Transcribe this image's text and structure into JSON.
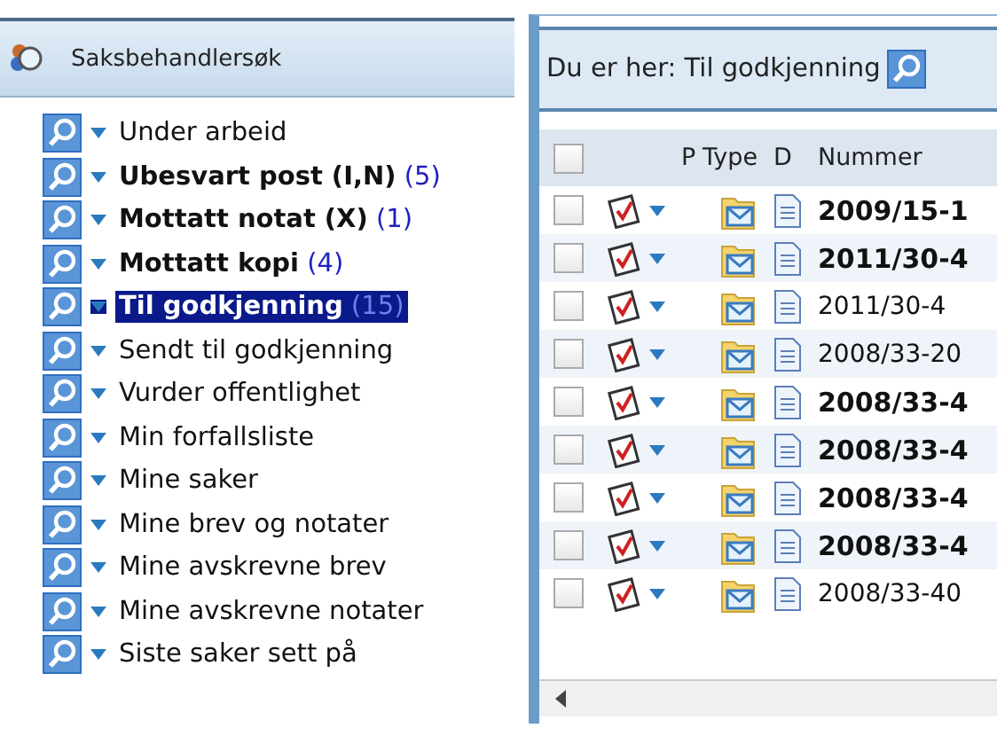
{
  "left_panel": {
    "title": "Saksbehandlersøk",
    "items": [
      {
        "label": "Under arbeid",
        "bold": false,
        "selected": false
      },
      {
        "label": "Ubesvart post (I,N)",
        "count": "(5)",
        "bold": true,
        "selected": false
      },
      {
        "label": "Mottatt notat (X)",
        "count": "(1)",
        "bold": true,
        "selected": false
      },
      {
        "label": "Mottatt kopi",
        "count": "(4)",
        "bold": true,
        "selected": false
      },
      {
        "label": "Til godkjenning",
        "count": "(15)",
        "bold": true,
        "selected": true
      },
      {
        "label": "Sendt til godkjenning",
        "bold": false,
        "selected": false
      },
      {
        "label": "Vurder offentlighet",
        "bold": false,
        "selected": false
      },
      {
        "label": "Min forfallsliste",
        "bold": false,
        "selected": false
      },
      {
        "label": "Mine saker",
        "bold": false,
        "selected": false
      },
      {
        "label": "Mine brev og notater",
        "bold": false,
        "selected": false
      },
      {
        "label": "Mine avskrevne brev",
        "bold": false,
        "selected": false
      },
      {
        "label": "Mine avskrevne notater",
        "bold": false,
        "selected": false
      },
      {
        "label": "Siste saker sett på",
        "bold": false,
        "selected": false
      }
    ]
  },
  "right_panel": {
    "breadcrumb": "Du er her: Til godkjenning",
    "table": {
      "select_all": {
        "checked": false
      },
      "columns": [
        "P",
        "Type",
        "D",
        "Nummer"
      ],
      "rows": [
        {
          "number": "2009/15-1",
          "bold": true,
          "checked": false
        },
        {
          "number": "2011/30-4",
          "bold": true,
          "checked": false
        },
        {
          "number": "2011/30-4",
          "bold": false,
          "checked": false
        },
        {
          "number": "2008/33-20",
          "bold": false,
          "checked": false
        },
        {
          "number": "2008/33-4",
          "bold": true,
          "checked": false
        },
        {
          "number": "2008/33-4",
          "bold": true,
          "checked": false
        },
        {
          "number": "2008/33-4",
          "bold": true,
          "checked": false
        },
        {
          "number": "2008/33-4",
          "bold": true,
          "checked": false
        },
        {
          "number": "2008/33-40",
          "bold": false,
          "checked": false
        }
      ]
    }
  }
}
